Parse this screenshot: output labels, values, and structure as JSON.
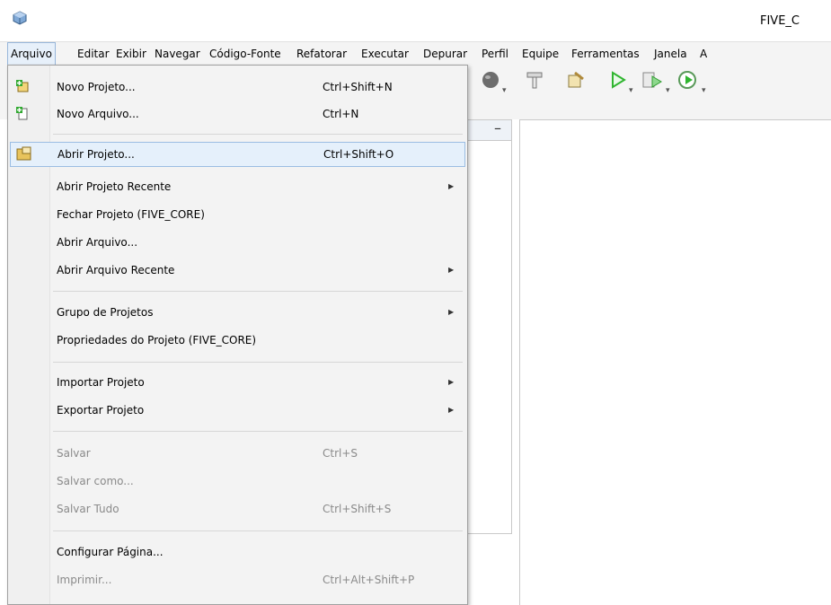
{
  "window": {
    "title": "FIVE_C"
  },
  "menubar": {
    "items": [
      "Arquivo",
      "Editar",
      "Exibir",
      "Navegar",
      "Código-Fonte",
      "Refatorar",
      "Executar",
      "Depurar",
      "Perfil",
      "Equipe",
      "Ferramentas",
      "Janela",
      "A"
    ]
  },
  "toolbar": {
    "icons": [
      "globe-icon",
      "hammer-icon",
      "clean-build-icon",
      "run-icon",
      "debug-icon",
      "profile-icon"
    ]
  },
  "file_menu": {
    "items": [
      {
        "label": "Novo Projeto...",
        "shortcut": "Ctrl+Shift+N"
      },
      {
        "label": "Novo Arquivo...",
        "shortcut": "Ctrl+N"
      },
      {
        "label": "Abrir Projeto...",
        "shortcut": "Ctrl+Shift+O"
      },
      {
        "label": "Abrir Projeto Recente",
        "shortcut": ""
      },
      {
        "label": "Fechar Projeto (FIVE_CORE)",
        "shortcut": ""
      },
      {
        "label": "Abrir Arquivo...",
        "shortcut": ""
      },
      {
        "label": "Abrir Arquivo Recente",
        "shortcut": ""
      },
      {
        "label": "Grupo de Projetos",
        "shortcut": ""
      },
      {
        "label": "Propriedades  do Projeto (FIVE_CORE)",
        "shortcut": ""
      },
      {
        "label": "Importar Projeto",
        "shortcut": ""
      },
      {
        "label": "Exportar Projeto",
        "shortcut": ""
      },
      {
        "label": "Salvar",
        "shortcut": "Ctrl+S"
      },
      {
        "label": "Salvar como...",
        "shortcut": ""
      },
      {
        "label": "Salvar Tudo",
        "shortcut": "Ctrl+Shift+S"
      },
      {
        "label": "Configurar Página...",
        "shortcut": ""
      },
      {
        "label": "Imprimir...",
        "shortcut": "Ctrl+Alt+Shift+P"
      }
    ]
  },
  "colors": {
    "highlight": "#e5f0fb",
    "highlight_border": "#9bbde3",
    "disabled_text": "#8a8a8a",
    "run_green": "#2fb52f"
  }
}
